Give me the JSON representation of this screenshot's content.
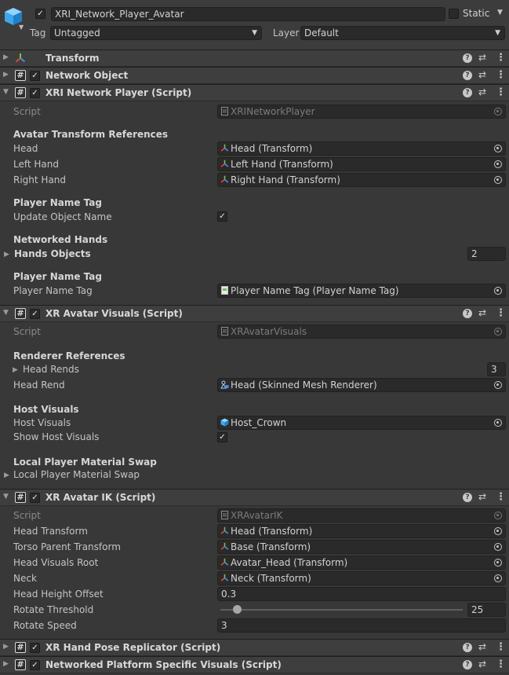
{
  "header": {
    "object_name": "XRI_Network_Player_Avatar",
    "active": true,
    "static_label": "Static",
    "static": false,
    "tag_label": "Tag",
    "tag_value": "Untagged",
    "layer_label": "Layer",
    "layer_value": "Default",
    "icon": "cube-icon"
  },
  "components": {
    "transform": {
      "title": "Transform",
      "icon": "transform-icon"
    },
    "network_object": {
      "title": "Network Object",
      "enabled": true
    },
    "xri_network_player": {
      "title": "XRI Network Player (Script)",
      "enabled": true,
      "script_label": "Script",
      "script_value": "XRINetworkPlayer",
      "section_avatar": "Avatar Transform References",
      "head_label": "Head",
      "head_value": "Head (Transform)",
      "left_hand_label": "Left Hand",
      "left_hand_value": "Left Hand (Transform)",
      "right_hand_label": "Right Hand",
      "right_hand_value": "Right Hand (Transform)",
      "section_name_tag": "Player Name Tag",
      "update_name_label": "Update Object Name",
      "update_name": true,
      "section_networked_hands": "Networked Hands",
      "hands_objects_label": "Hands Objects",
      "hands_objects_count": "2",
      "section_name_tag2": "Player Name Tag",
      "name_tag_label": "Player Name Tag",
      "name_tag_value": "Player Name Tag (Player Name Tag)"
    },
    "xr_avatar_visuals": {
      "title": "XR Avatar Visuals (Script)",
      "enabled": true,
      "script_label": "Script",
      "script_value": "XRAvatarVisuals",
      "section_renderer": "Renderer References",
      "head_rends_label": "Head Rends",
      "head_rends_count": "3",
      "head_rend_label": "Head Rend",
      "head_rend_value": "Head (Skinned Mesh Renderer)",
      "section_host": "Host Visuals",
      "host_visuals_label": "Host Visuals",
      "host_visuals_value": "Host_Crown",
      "show_host_label": "Show Host Visuals",
      "show_host": true,
      "section_material": "Local Player Material Swap",
      "material_swap_label": "Local Player Material Swap"
    },
    "xr_avatar_ik": {
      "title": "XR Avatar IK (Script)",
      "enabled": true,
      "script_label": "Script",
      "script_value": "XRAvatarIK",
      "head_transform_label": "Head Transform",
      "head_transform_value": "Head (Transform)",
      "torso_label": "Torso Parent Transform",
      "torso_value": "Base (Transform)",
      "head_visuals_label": "Head Visuals Root",
      "head_visuals_value": "Avatar_Head (Transform)",
      "neck_label": "Neck",
      "neck_value": "Neck (Transform)",
      "height_offset_label": "Head Height Offset",
      "height_offset_value": "0.3",
      "rotate_threshold_label": "Rotate Threshold",
      "rotate_threshold_value": "25",
      "rotate_threshold_fraction": 0.07,
      "rotate_speed_label": "Rotate Speed",
      "rotate_speed_value": "3"
    },
    "xr_hand_pose": {
      "title": "XR Hand Pose Replicator (Script)",
      "enabled": true
    },
    "platform_visuals": {
      "title": "Networked Platform Specific Visuals (Script)",
      "enabled": true
    }
  },
  "colors": {
    "background": "#383838",
    "header_bg": "#3e3e3e",
    "field_bg": "#2a2a2a",
    "text": "#c4c4c4",
    "transform_red": "#e0473a",
    "transform_green": "#7bc443",
    "transform_blue": "#4a8fe8"
  }
}
